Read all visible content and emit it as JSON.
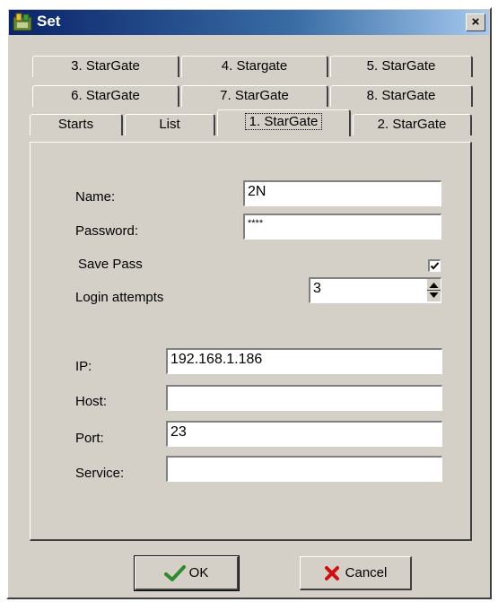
{
  "window": {
    "title": "Set",
    "close_label": "×"
  },
  "tabs": {
    "row1": [
      "3. StarGate",
      "4. Stargate",
      "5. StarGate"
    ],
    "row2": [
      "6. StarGate",
      "7. StarGate",
      "8. StarGate"
    ],
    "row3": [
      "Starts",
      "List",
      "1. StarGate",
      "2. StarGate"
    ],
    "active": "1. StarGate"
  },
  "form": {
    "name_label": "Name:",
    "name_value": "2N",
    "password_label": "Password:",
    "password_value": "****",
    "save_pass_label": "Save Pass",
    "save_pass_checked": true,
    "login_attempts_label": "Login attempts",
    "login_attempts_value": "3",
    "ip_label": "IP:",
    "ip_value": "192.168.1.186",
    "host_label": "Host:",
    "host_value": "",
    "port_label": "Port:",
    "port_value": "23",
    "service_label": "Service:",
    "service_value": ""
  },
  "buttons": {
    "ok": "OK",
    "cancel": "Cancel"
  },
  "icons": {
    "app": "app-icon",
    "close": "close-icon",
    "check": "checkmark-icon",
    "cancel": "x-icon",
    "spin_up": "triangle-up-icon",
    "spin_down": "triangle-down-icon"
  },
  "colors": {
    "titlebar": "#0a246a",
    "face": "#d4d0c8",
    "ok_check": "#2e8b2e",
    "cancel_x": "#d01010"
  }
}
